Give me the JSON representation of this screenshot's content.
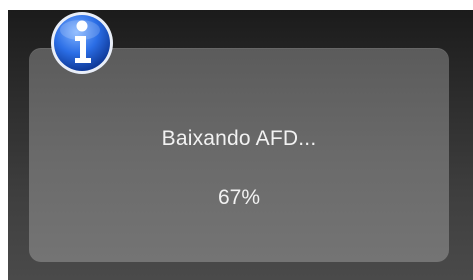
{
  "dialog": {
    "icon": "info-icon",
    "message": "Baixando AFD...",
    "progress_text": "67%",
    "progress": 0.67
  },
  "colors": {
    "icon_blue": "#1f5fd6",
    "text": "#f2f2f2"
  }
}
